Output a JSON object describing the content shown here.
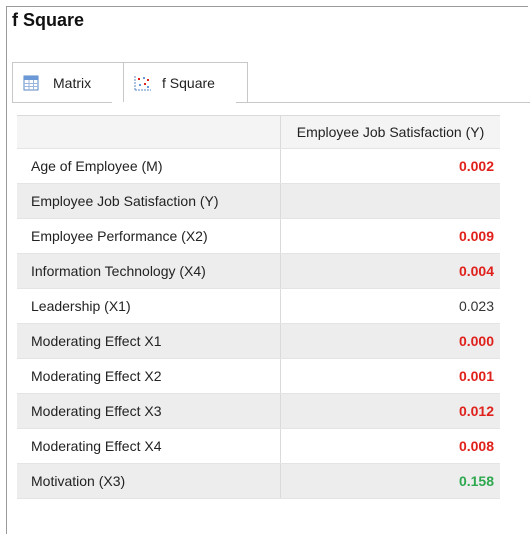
{
  "title": "f Square",
  "tabs": [
    {
      "label": "Matrix",
      "icon": "table-icon"
    },
    {
      "label": "f Square",
      "icon": "scatter-icon"
    }
  ],
  "colors": {
    "significant": "#e0201b",
    "large": "#2ea84f",
    "neutral": "#333333"
  },
  "table": {
    "column_header": "Employee  Job Satisfaction (Y)",
    "rows": [
      {
        "label": "Age of Employee (M)",
        "value": "0.002",
        "style": "red"
      },
      {
        "label": "Employee  Job Satisfaction (Y)",
        "value": "",
        "style": "empty"
      },
      {
        "label": "Employee Performance (X2)",
        "value": "0.009",
        "style": "red"
      },
      {
        "label": "Information Technology (X4)",
        "value": "0.004",
        "style": "red"
      },
      {
        "label": "Leadership (X1)",
        "value": "0.023",
        "style": "plain"
      },
      {
        "label": "Moderating Effect X1",
        "value": "0.000",
        "style": "red"
      },
      {
        "label": "Moderating Effect X2",
        "value": "0.001",
        "style": "red"
      },
      {
        "label": "Moderating Effect X3",
        "value": "0.012",
        "style": "red"
      },
      {
        "label": "Moderating Effect X4",
        "value": "0.008",
        "style": "red"
      },
      {
        "label": "Motivation (X3)",
        "value": "0.158",
        "style": "green"
      }
    ]
  }
}
